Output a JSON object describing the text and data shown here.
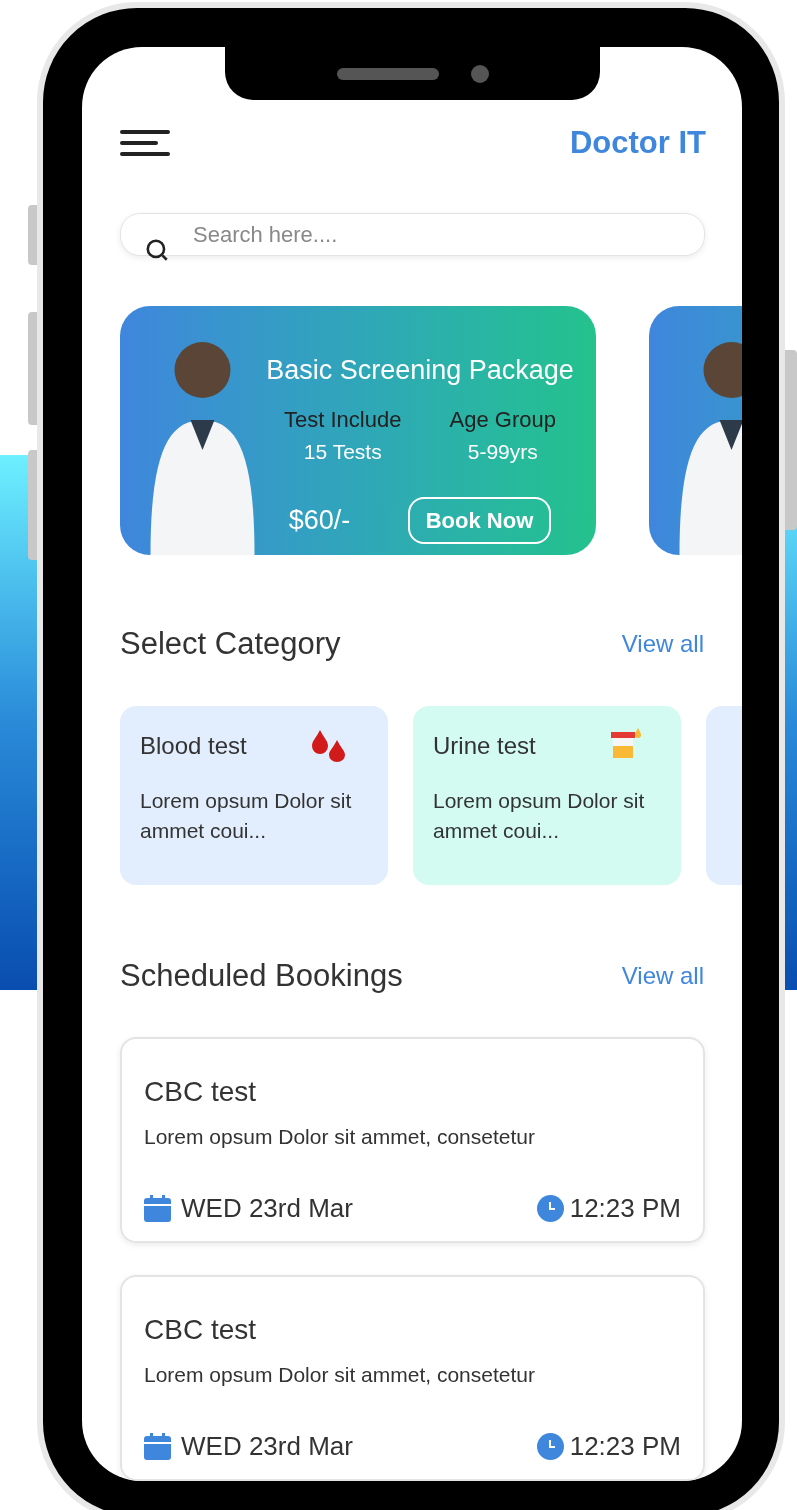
{
  "header": {
    "title": "Doctor IT"
  },
  "search": {
    "placeholder": "Search here...."
  },
  "packages": [
    {
      "kind": "offer",
      "title": "Basic Screening Package",
      "stats": [
        {
          "label": "Test Include",
          "value": "15 Tests"
        },
        {
          "label": "Age Group",
          "value": "5-99yrs"
        }
      ],
      "price": "$60/-",
      "button": "Book Now"
    },
    {
      "kind": "peek"
    }
  ],
  "categories_section": {
    "title": "Select Category",
    "link": "View all"
  },
  "categories": [
    {
      "kind": "blood",
      "title": "Blood test",
      "text": "Lorem opsum Dolor sit ammet coui...",
      "color": "#e2eefd"
    },
    {
      "kind": "urine",
      "title": "Urine test",
      "text": "Lorem opsum Dolor sit ammet coui...",
      "color": "#d3fbf1"
    },
    {
      "kind": "partial",
      "color": "#e2eefd"
    }
  ],
  "bookings_section": {
    "title": "Scheduled Bookings",
    "link": "View all"
  },
  "bookings": [
    {
      "title": "CBC test",
      "text": "Lorem opsum Dolor sit ammet, consetetur",
      "date": "WED 23rd Mar",
      "time": "12:23 PM"
    },
    {
      "title": "CBC test",
      "text": "Lorem opsum Dolor sit ammet, consetetur",
      "date": "WED 23rd Mar",
      "time": "12:23 PM"
    }
  ]
}
